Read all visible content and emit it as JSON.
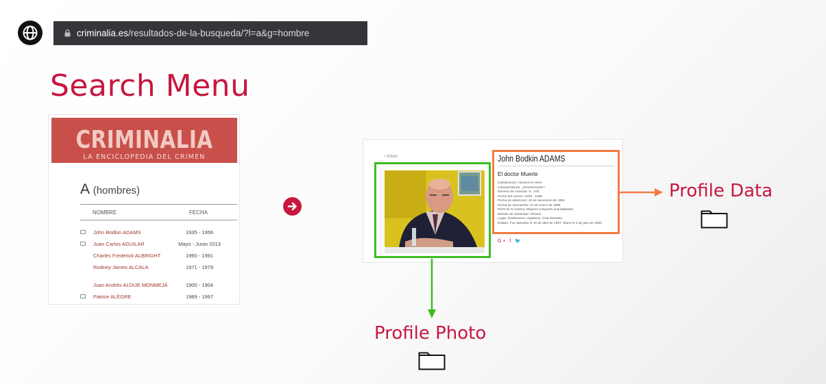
{
  "browser": {
    "url_host": "criminalia.es",
    "url_path": "/resultados-de-la-busqueda/?l=a&g=hombre"
  },
  "search_menu": {
    "title": "Search Menu",
    "site_name": "CRIMINALIA",
    "site_tagline": "LA ENCICLOPEDIA DEL CRIMEN",
    "letter": "A",
    "letter_group": "(hombres)",
    "col_name": "NOMBRE",
    "col_date": "FECHA",
    "rows": [
      {
        "name": "John Bodkin ADAMS",
        "date": "1935 - 1956"
      },
      {
        "name": "Juan Carlos AGUILAR",
        "date": "Mayo - Junio 2013"
      },
      {
        "name": "Charles Frederick ALBRIGHT",
        "date": "1990 - 1991"
      },
      {
        "name": "Rodney James ALCALA",
        "date": "1971 - 1979"
      },
      {
        "name": "Juan Andrés ALDIJE MONMEJÁ",
        "date": "1900 - 1904"
      },
      {
        "name": "Patrice ALÈGRE",
        "date": "1989 - 1997"
      }
    ]
  },
  "profile": {
    "back_label": "‹ Volver",
    "name": "John Bodkin ADAMS",
    "alias": "El doctor Muerte",
    "facts": [
      "Clasificación: Asesino en serie",
      "Características: ¿Envenenador?",
      "Número de víctimas: 9 - 163",
      "Fecha del crimen: 1935 - 1956",
      "Fecha de detención: 19 de diciembre de 1956",
      "Fecha de nacimiento: 21 de enero de 1899",
      "Perfil de la víctima: Mujeres (mayores acaudaladas)",
      "Método de asesinato: Veneno",
      "Lugar: Eastbourne, Inglaterra, Gran Bretaña",
      "Estado: Fue absuelto el 15 de abril de 1957. Murió el 4 de julio de 1983"
    ],
    "social": "G+ f 🐦"
  },
  "labels": {
    "profile_data": "Profile Data",
    "profile_photo": "Profile Photo"
  },
  "colors": {
    "accent": "#c7173f",
    "photo_highlight": "#3cbd1f",
    "data_highlight": "#f47a40",
    "banner": "#c9504a"
  },
  "icons": [
    "globe-icon",
    "lock-icon",
    "arrow-right-circle-icon",
    "folder-icon"
  ]
}
